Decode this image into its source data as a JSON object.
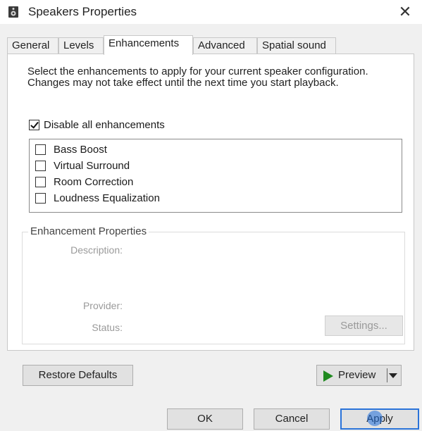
{
  "window": {
    "title": "Speakers Properties",
    "close_glyph": "✕",
    "icon": "speaker-icon"
  },
  "tabs": [
    {
      "label": "General",
      "active": false
    },
    {
      "label": "Levels",
      "active": false
    },
    {
      "label": "Enhancements",
      "active": true
    },
    {
      "label": "Advanced",
      "active": false
    },
    {
      "label": "Spatial sound",
      "active": false
    }
  ],
  "panel": {
    "description": "Select the enhancements to apply for your current speaker configuration. Changes may not take effect until the next time you start playback.",
    "disable_all": {
      "label": "Disable all enhancements",
      "checked": true
    },
    "enhancements": [
      {
        "label": "Bass Boost",
        "checked": false
      },
      {
        "label": "Virtual Surround",
        "checked": false
      },
      {
        "label": "Room Correction",
        "checked": false
      },
      {
        "label": "Loudness Equalization",
        "checked": false
      }
    ],
    "properties": {
      "title": "Enhancement Properties",
      "description_label": "Description:",
      "provider_label": "Provider:",
      "status_label": "Status:",
      "settings_button": "Settings..."
    }
  },
  "buttons": {
    "restore_defaults": "Restore Defaults",
    "preview": "Preview",
    "ok": "OK",
    "cancel": "Cancel",
    "apply": "Apply"
  },
  "colors": {
    "accent": "#2a73d9",
    "play": "#1f8a1f"
  }
}
